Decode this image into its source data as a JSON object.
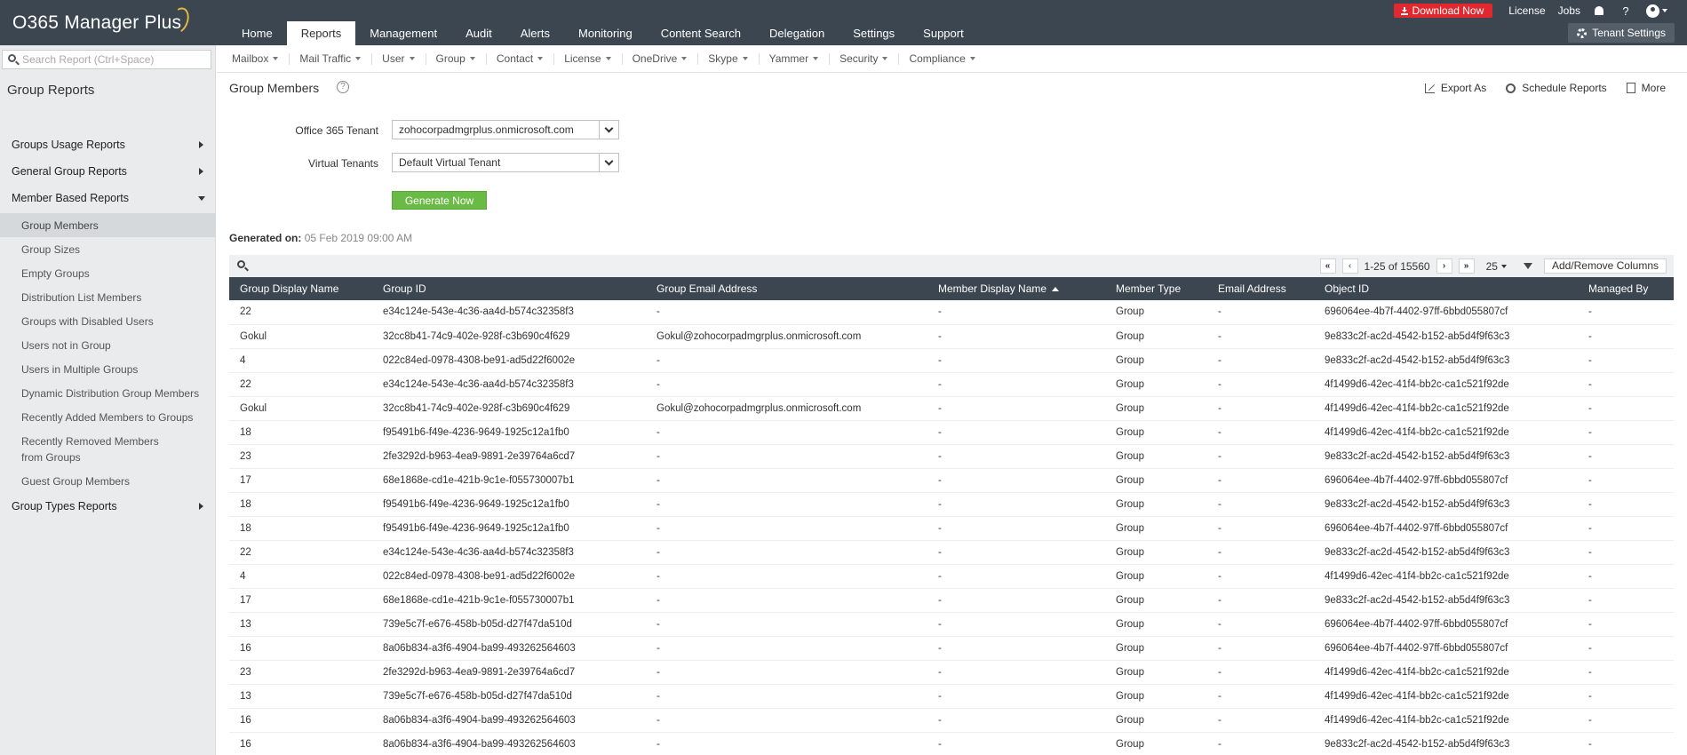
{
  "app": {
    "logo": "O365 Manager Plus",
    "nav_tabs": [
      "Home",
      "Reports",
      "Management",
      "Audit",
      "Alerts",
      "Monitoring",
      "Content Search",
      "Delegation",
      "Settings",
      "Support"
    ],
    "active_tab": "Reports",
    "download_label": "Download Now",
    "license_label": "License",
    "jobs_label": "Jobs",
    "help_glyph": "?",
    "tenant_settings_label": "Tenant Settings",
    "brand_color": "#3c4650",
    "download_color": "#e0282e",
    "generate_color": "#6abb45"
  },
  "subnav": [
    "Mailbox",
    "Mail Traffic",
    "User",
    "Group",
    "Contact",
    "License",
    "OneDrive",
    "Skype",
    "Yammer",
    "Security",
    "Compliance"
  ],
  "sidebar": {
    "search_placeholder": "Search Report (Ctrl+Space)",
    "title": "Group Reports",
    "groups": [
      {
        "label": "Groups Usage Reports",
        "expanded": false
      },
      {
        "label": "General Group Reports",
        "expanded": false
      },
      {
        "label": "Member Based Reports",
        "expanded": true
      },
      {
        "label": "Group Types Reports",
        "expanded": false
      }
    ],
    "member_items": [
      "Group Members",
      "Group Sizes",
      "Empty Groups",
      "Distribution List Members",
      "Groups with Disabled Users",
      "Users not in Group",
      "Users in Multiple Groups",
      "Dynamic Distribution Group Members",
      "Recently Added Members to Groups",
      "Recently Removed Members from Groups",
      "Guest Group Members"
    ],
    "active_item": "Group Members"
  },
  "main": {
    "title": "Group Members",
    "help_glyph": "?",
    "actions": [
      "Export As",
      "Schedule Reports",
      "More"
    ],
    "tenant_label": "Office 365 Tenant",
    "tenant_value": "zohocorpadmgrplus.onmicrosoft.com",
    "virtual_label": "Virtual Tenants",
    "virtual_value": "Default Virtual Tenant",
    "generate_label": "Generate Now",
    "generated_label": "Generated on:",
    "generated_value": "05 Feb 2019 09:00 AM"
  },
  "pager": {
    "first": "«",
    "prev": "‹",
    "range": "1-25 of 15560",
    "next": "›",
    "last": "»",
    "page_size": "25",
    "add_remove": "Add/Remove Columns"
  },
  "table": {
    "columns": [
      "Group Display Name",
      "Group ID",
      "Group Email Address",
      "Member Display Name",
      "Member Type",
      "Email Address",
      "Object ID",
      "Managed By"
    ],
    "sorted_column": "Member Display Name",
    "rows": [
      [
        "22",
        "e34c124e-543e-4c36-aa4d-b574c32358f3",
        "-",
        "-",
        "Group",
        "-",
        "696064ee-4b7f-4402-97ff-6bbd055807cf",
        "-"
      ],
      [
        "Gokul",
        "32cc8b41-74c9-402e-928f-c3b690c4f629",
        "Gokul@zohocorpadmgrplus.onmicrosoft.com",
        "-",
        "Group",
        "-",
        "9e833c2f-ac2d-4542-b152-ab5d4f9f63c3",
        "-"
      ],
      [
        "4",
        "022c84ed-0978-4308-be91-ad5d22f6002e",
        "-",
        "-",
        "Group",
        "-",
        "9e833c2f-ac2d-4542-b152-ab5d4f9f63c3",
        "-"
      ],
      [
        "22",
        "e34c124e-543e-4c36-aa4d-b574c32358f3",
        "-",
        "-",
        "Group",
        "-",
        "4f1499d6-42ec-41f4-bb2c-ca1c521f92de",
        "-"
      ],
      [
        "Gokul",
        "32cc8b41-74c9-402e-928f-c3b690c4f629",
        "Gokul@zohocorpadmgrplus.onmicrosoft.com",
        "-",
        "Group",
        "-",
        "4f1499d6-42ec-41f4-bb2c-ca1c521f92de",
        "-"
      ],
      [
        "18",
        "f95491b6-f49e-4236-9649-1925c12a1fb0",
        "-",
        "-",
        "Group",
        "-",
        "4f1499d6-42ec-41f4-bb2c-ca1c521f92de",
        "-"
      ],
      [
        "23",
        "2fe3292d-b963-4ea9-9891-2e39764a6cd7",
        "-",
        "-",
        "Group",
        "-",
        "9e833c2f-ac2d-4542-b152-ab5d4f9f63c3",
        "-"
      ],
      [
        "17",
        "68e1868e-cd1e-421b-9c1e-f055730007b1",
        "-",
        "-",
        "Group",
        "-",
        "696064ee-4b7f-4402-97ff-6bbd055807cf",
        "-"
      ],
      [
        "18",
        "f95491b6-f49e-4236-9649-1925c12a1fb0",
        "-",
        "-",
        "Group",
        "-",
        "9e833c2f-ac2d-4542-b152-ab5d4f9f63c3",
        "-"
      ],
      [
        "18",
        "f95491b6-f49e-4236-9649-1925c12a1fb0",
        "-",
        "-",
        "Group",
        "-",
        "696064ee-4b7f-4402-97ff-6bbd055807cf",
        "-"
      ],
      [
        "22",
        "e34c124e-543e-4c36-aa4d-b574c32358f3",
        "-",
        "-",
        "Group",
        "-",
        "9e833c2f-ac2d-4542-b152-ab5d4f9f63c3",
        "-"
      ],
      [
        "4",
        "022c84ed-0978-4308-be91-ad5d22f6002e",
        "-",
        "-",
        "Group",
        "-",
        "4f1499d6-42ec-41f4-bb2c-ca1c521f92de",
        "-"
      ],
      [
        "17",
        "68e1868e-cd1e-421b-9c1e-f055730007b1",
        "-",
        "-",
        "Group",
        "-",
        "9e833c2f-ac2d-4542-b152-ab5d4f9f63c3",
        "-"
      ],
      [
        "13",
        "739e5c7f-e676-458b-b05d-d27f47da510d",
        "-",
        "-",
        "Group",
        "-",
        "696064ee-4b7f-4402-97ff-6bbd055807cf",
        "-"
      ],
      [
        "16",
        "8a06b834-a3f6-4904-ba99-493262564603",
        "-",
        "-",
        "Group",
        "-",
        "696064ee-4b7f-4402-97ff-6bbd055807cf",
        "-"
      ],
      [
        "23",
        "2fe3292d-b963-4ea9-9891-2e39764a6cd7",
        "-",
        "-",
        "Group",
        "-",
        "4f1499d6-42ec-41f4-bb2c-ca1c521f92de",
        "-"
      ],
      [
        "13",
        "739e5c7f-e676-458b-b05d-d27f47da510d",
        "-",
        "-",
        "Group",
        "-",
        "4f1499d6-42ec-41f4-bb2c-ca1c521f92de",
        "-"
      ],
      [
        "16",
        "8a06b834-a3f6-4904-ba99-493262564603",
        "-",
        "-",
        "Group",
        "-",
        "4f1499d6-42ec-41f4-bb2c-ca1c521f92de",
        "-"
      ],
      [
        "16",
        "8a06b834-a3f6-4904-ba99-493262564603",
        "-",
        "-",
        "Group",
        "-",
        "9e833c2f-ac2d-4542-b152-ab5d4f9f63c3",
        "-"
      ]
    ]
  }
}
